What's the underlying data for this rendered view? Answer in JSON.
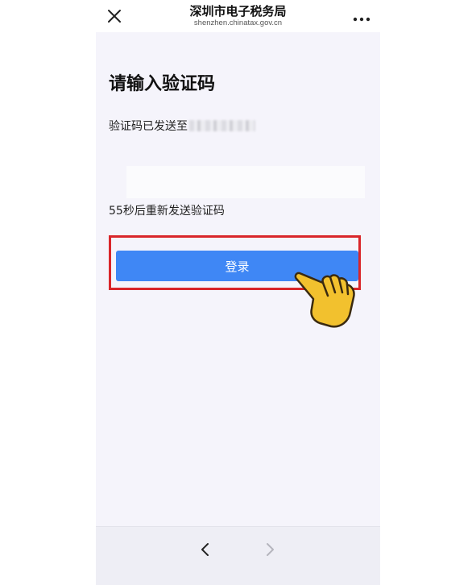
{
  "header": {
    "title": "深圳市电子税务局",
    "subtitle": "shenzhen.chinatax.gov.cn",
    "close_icon": "close-icon",
    "more_icon": "more-dots-icon"
  },
  "main": {
    "heading": "请输入验证码",
    "sent_label": "验证码已发送至",
    "resend_text": "55秒后重新发送验证码",
    "login_label": "登录"
  },
  "footer": {
    "back_icon": "chevron-left-icon",
    "forward_icon": "chevron-right-icon"
  },
  "colors": {
    "primary_button": "#3f87f5",
    "highlight_frame": "#d9262a",
    "hand": "#f2c12e"
  }
}
